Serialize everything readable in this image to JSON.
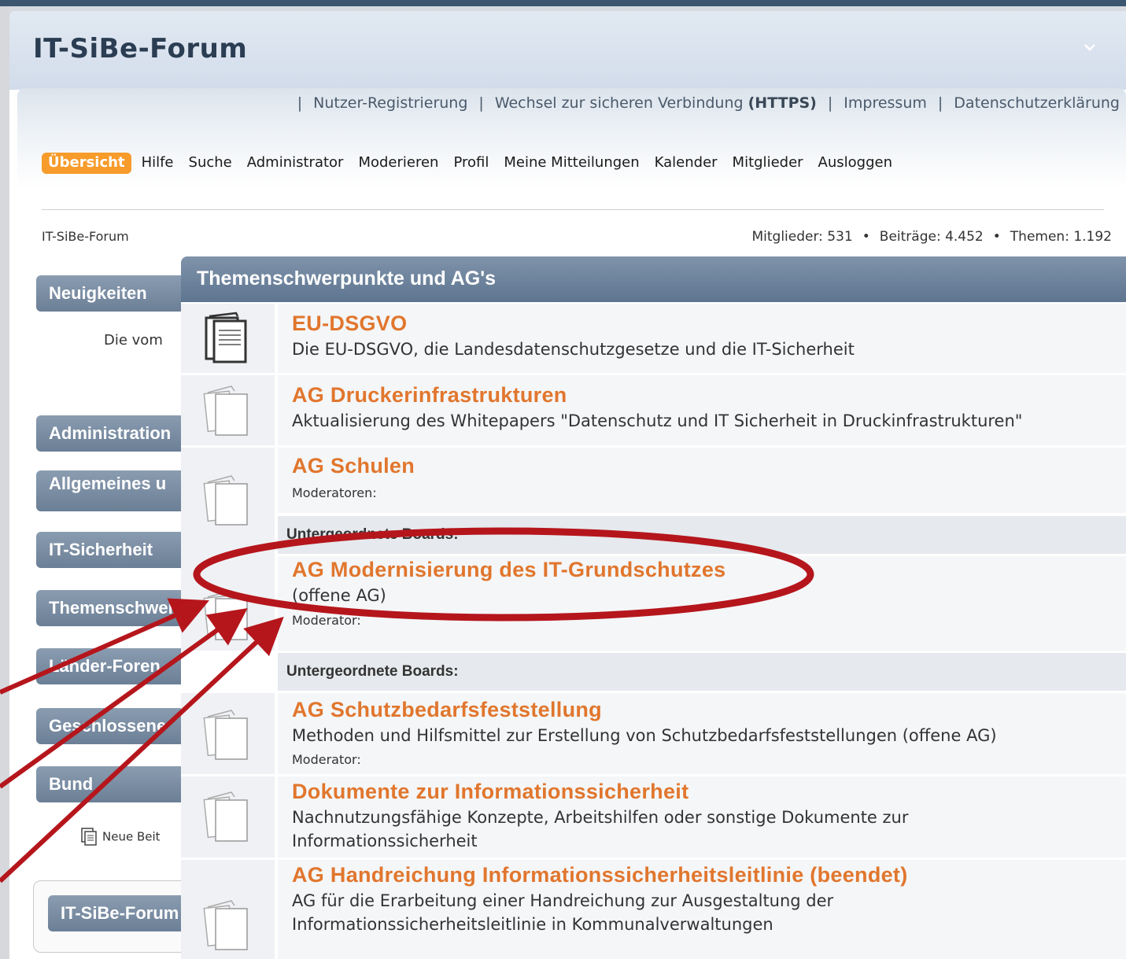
{
  "header": {
    "site_title": "IT-SiBe-Forum"
  },
  "toplinks": {
    "sep": "|",
    "register": "Nutzer-Registrierung",
    "https_prefix": "Wechsel zur sicheren Verbindung",
    "https_bold": "(HTTPS)",
    "impressum": "Impressum",
    "privacy": "Datenschutzerklärung"
  },
  "nav": {
    "items": [
      "Übersicht",
      "Hilfe",
      "Suche",
      "Administrator",
      "Moderieren",
      "Profil",
      "Meine Mitteilungen",
      "Kalender",
      "Mitglieder",
      "Ausloggen"
    ],
    "active_index": 0
  },
  "breadcrumb": "IT-SiBe-Forum",
  "stats": {
    "members": "Mitglieder: 531",
    "posts": "Beiträge: 4.452",
    "topics": "Themen: 1.192",
    "dot": "•"
  },
  "sidebar": {
    "buttons": [
      "Neuigkeiten",
      "Administration",
      "Allgemeines u",
      "IT-Sicherheit",
      "Themenschwerpunkte",
      "Länder-Foren",
      "Geschlossene",
      "Bund",
      "IT-SiBe-Forum"
    ],
    "news_text": "Die vom",
    "new_posts": "Neue Beit"
  },
  "board": {
    "title": "Themenschwerpunkte und AG's",
    "subboards_label": "Untergeordnete Boards:",
    "forums": [
      {
        "name": "EU-DSGVO",
        "desc": "Die EU-DSGVO, die Landesdatenschutzgesetze und die IT-Sicherheit",
        "new_posts": true
      },
      {
        "name": "AG Druckerinfrastrukturen",
        "desc": "Aktualisierung des Whitepapers \"Datenschutz und IT Sicherheit in Druckinfrastrukturen\"",
        "new_posts": false
      },
      {
        "name": "AG Schulen",
        "mod": "Moderatoren:",
        "new_posts": false
      },
      {
        "name": "AG Modernisierung des IT-Grundschutzes",
        "desc": "(offene AG)",
        "mod": "Moderator:",
        "new_posts": false
      },
      {
        "name": "AG Schutzbedarfsfeststellung",
        "desc": "Methoden und Hilfsmittel zur Erstellung von Schutzbedarfsfeststellungen (offene AG)",
        "mod": "Moderator:",
        "new_posts": false
      },
      {
        "name": "Dokumente zur Informationssicherheit",
        "desc": "Nachnutzungsfähige Konzepte, Arbeitshilfen oder sonstige Dokumente zur",
        "desc2": "Informationssicherheit",
        "new_posts": false
      },
      {
        "name": "AG Handreichung Informationssicherheitsleitlinie (beendet)",
        "desc": "AG für die Erarbeitung einer Handreichung zur Ausgestaltung der",
        "desc2": "Informationssicherheitsleitlinie in Kommunalverwaltungen",
        "new_posts": false
      }
    ]
  },
  "annotation": {
    "color": "#b5161c",
    "highlighted_forum": "AG Modernisierung des IT-Grundschutzes"
  }
}
